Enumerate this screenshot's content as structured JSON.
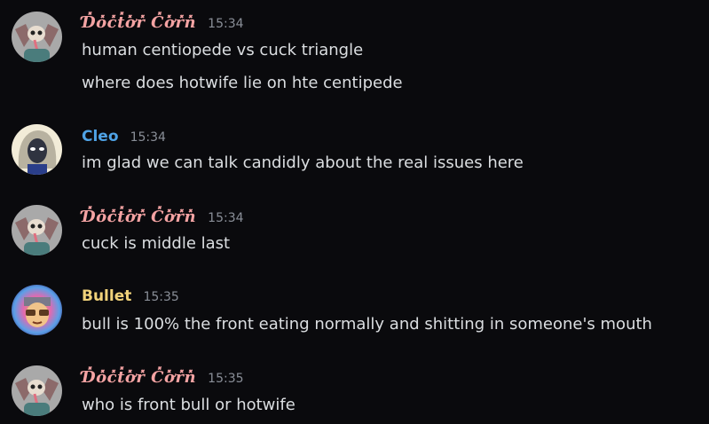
{
  "messages": [
    {
      "author": "Ɗ̽o̽c̽t̽ơ̽r̽ C̽ơ̽r̽n̽",
      "author_color": "#f4a3a3",
      "timestamp": "15:34",
      "avatar_icon": "skull-bat-avatar",
      "lines": [
        "human centiopede vs cuck triangle",
        "where does hotwife lie on hte centipede"
      ]
    },
    {
      "author": "Cleo",
      "author_color": "#4fa3e6",
      "timestamp": "15:34",
      "avatar_icon": "grey-haired-character-avatar",
      "lines": [
        "im glad we can talk candidly about the real issues here"
      ]
    },
    {
      "author": "Ɗ̽o̽c̽t̽ơ̽r̽ C̽ơ̽r̽n̽",
      "author_color": "#f4a3a3",
      "timestamp": "15:34",
      "avatar_icon": "skull-bat-avatar",
      "lines": [
        "cuck is middle last"
      ]
    },
    {
      "author": "Bullet",
      "author_color": "#f0d27a",
      "timestamp": "15:35",
      "avatar_icon": "sunglasses-character-avatar",
      "lines": [
        "bull is 100% the front eating normally and shitting in someone's mouth"
      ]
    },
    {
      "author": "Ɗ̽o̽c̽t̽ơ̽r̽ C̽ơ̽r̽n̽",
      "author_color": "#f4a3a3",
      "timestamp": "15:35",
      "avatar_icon": "skull-bat-avatar",
      "lines": [
        "who is front bull or hotwife"
      ]
    }
  ]
}
